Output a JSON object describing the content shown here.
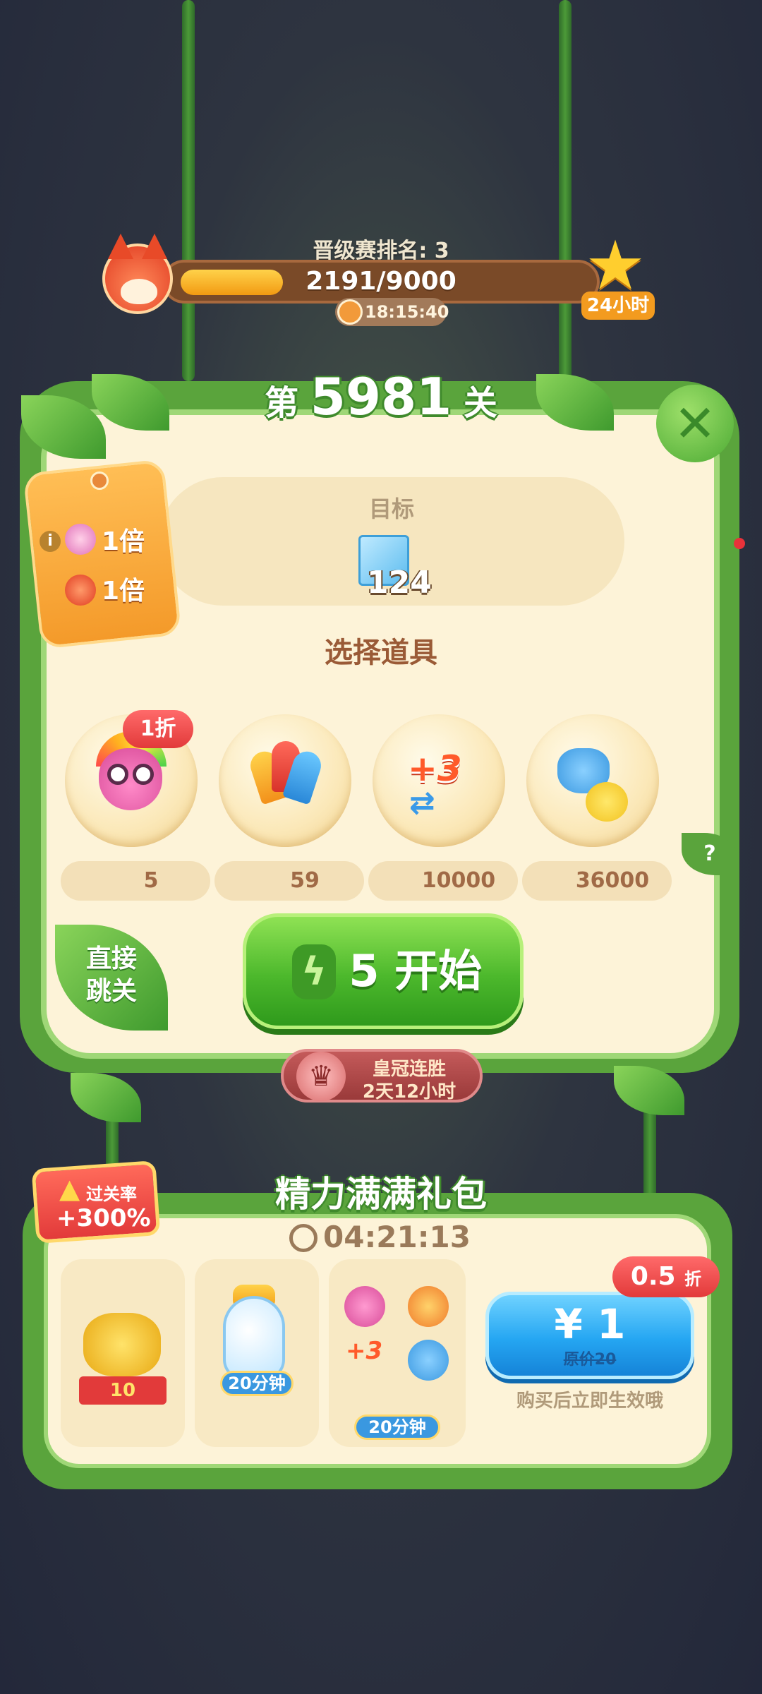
{
  "rank": {
    "label": "晋级赛排名: 3",
    "progress_text": "2191/9000",
    "progress_current": 2191,
    "progress_max": 9000,
    "timer": "18:15:40",
    "reward_duration": "24小时"
  },
  "level": {
    "prefix": "第",
    "number": "5981",
    "suffix": "关"
  },
  "goal": {
    "label": "目标",
    "count": "124",
    "item_icon": "ice-block-icon"
  },
  "multipliers": [
    {
      "icon": "owl-token-icon",
      "text": "1倍"
    },
    {
      "icon": "fox-token-icon",
      "text": "1倍"
    }
  ],
  "boosters": {
    "title": "选择道具",
    "items": [
      {
        "name": "rainbow-owl-icon",
        "price": "5",
        "currency": "gold-coin",
        "discount": "1折"
      },
      {
        "name": "rockets-icon",
        "price": "59",
        "currency": "gold-coin"
      },
      {
        "name": "plus3-moves-icon",
        "price": "10000",
        "currency": "silver-coin"
      },
      {
        "name": "creatures-icon",
        "price": "36000",
        "currency": "silver-coin"
      }
    ],
    "help": "?"
  },
  "actions": {
    "skip_line1": "直接",
    "skip_line2": "跳关",
    "start_cost": "5",
    "start_label": "开始"
  },
  "crown_streak": {
    "title": "皇冠连胜",
    "time": "2天12小时"
  },
  "gift": {
    "title": "精力满满礼包",
    "timer": "04:21:13",
    "rate_label": "过关率",
    "rate_value": "+300%",
    "coins_amount": "10",
    "bottle_duration": "20分钟",
    "booster_duration": "20分钟",
    "booster_plus": "+3",
    "price": "¥ 1",
    "original_price": "原价20",
    "discount_value": "0.5",
    "discount_unit": "折",
    "note": "购买后立即生效哦"
  },
  "colors": {
    "panel_green": "#5aa43c",
    "panel_cream": "#fdf3d8",
    "start_green": "#4cb82c",
    "buy_blue": "#25a6f2",
    "discount_red": "#e23a3a"
  }
}
